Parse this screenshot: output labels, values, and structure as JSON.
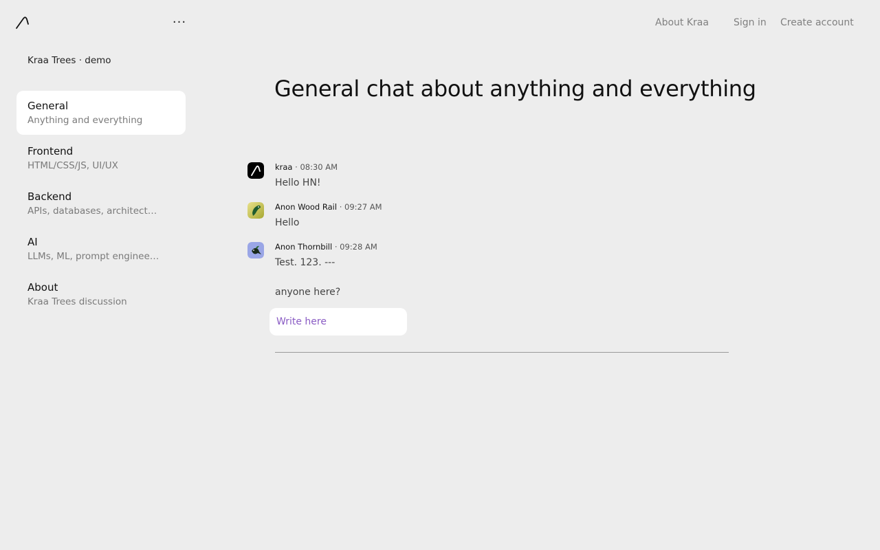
{
  "header": {
    "more_label": "···",
    "nav": {
      "about": "About Kraa",
      "sign_in": "Sign in",
      "create_account": "Create account"
    }
  },
  "sidebar": {
    "workspace": "Kraa Trees · demo",
    "channels": [
      {
        "name": "General",
        "description": "Anything and everything",
        "active": true
      },
      {
        "name": "Frontend",
        "description": "HTML/CSS/JS, UI/UX",
        "active": false
      },
      {
        "name": "Backend",
        "description": "APIs, databases, architecture",
        "active": false
      },
      {
        "name": "AI",
        "description": "LLMs, ML, prompt engineering",
        "active": false
      },
      {
        "name": "About",
        "description": "Kraa Trees discussion",
        "active": false
      }
    ]
  },
  "main": {
    "title": "General chat about anything and everything",
    "messages": [
      {
        "author": "kraa",
        "separator": "·",
        "time": "08:30 AM",
        "lines": [
          "Hello HN!"
        ],
        "avatar": "kraa-logo-icon"
      },
      {
        "author": "Anon Wood Rail",
        "separator": "·",
        "time": "09:27 AM",
        "lines": [
          "Hello"
        ],
        "avatar": "bird-avatar-icon"
      },
      {
        "author": "Anon Thornbill",
        "separator": "·",
        "time": "09:28 AM",
        "lines": [
          "Test. 123. ---",
          "anyone here?"
        ],
        "avatar": "bird-avatar-icon"
      }
    ],
    "composer": {
      "placeholder": "Write here"
    }
  },
  "colors": {
    "background": "#ededed",
    "active_channel": "#ffffff",
    "placeholder_accent": "#8a5cc4",
    "avatar_kraa": "#000000",
    "avatar_wood_rail": "#c8c24a",
    "avatar_thornbill": "#9aa6e6"
  }
}
